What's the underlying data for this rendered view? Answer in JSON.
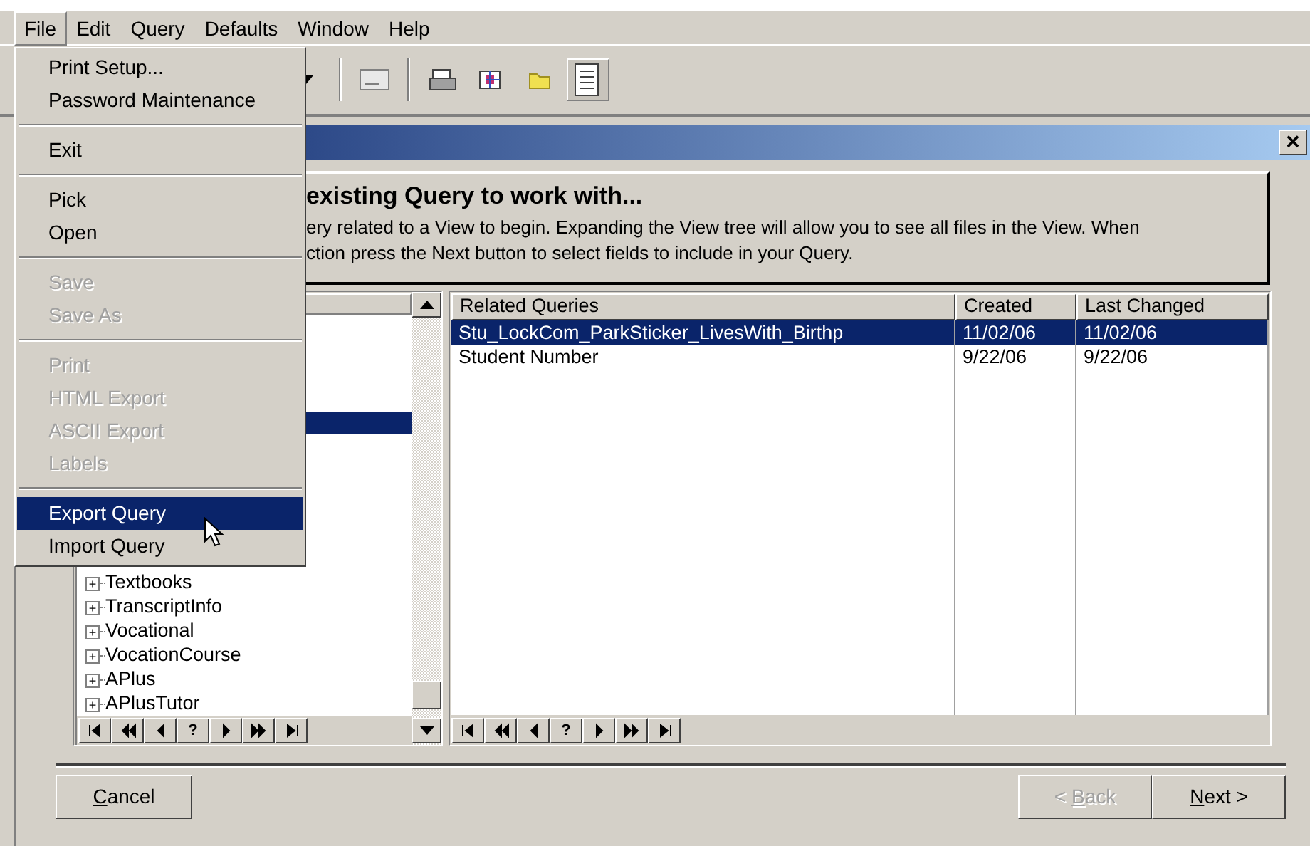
{
  "menu_bar": [
    {
      "label": "File",
      "selected": true
    },
    {
      "label": "Edit",
      "selected": false
    },
    {
      "label": "Query",
      "selected": false
    },
    {
      "label": "Defaults",
      "selected": false
    },
    {
      "label": "Window",
      "selected": false
    },
    {
      "label": "Help",
      "selected": false
    }
  ],
  "file_menu": [
    {
      "kind": "item",
      "label": "Print Setup...",
      "disabled": false,
      "selected": false
    },
    {
      "kind": "item",
      "label": "Password Maintenance",
      "disabled": false,
      "selected": false
    },
    {
      "kind": "separator"
    },
    {
      "kind": "item",
      "label": "Exit",
      "disabled": false,
      "selected": false
    },
    {
      "kind": "separator"
    },
    {
      "kind": "item",
      "label": "Pick",
      "disabled": false,
      "selected": false
    },
    {
      "kind": "item",
      "label": "Open",
      "disabled": false,
      "selected": false
    },
    {
      "kind": "separator"
    },
    {
      "kind": "item",
      "label": "Save",
      "disabled": true,
      "selected": false
    },
    {
      "kind": "item",
      "label": "Save As",
      "disabled": true,
      "selected": false
    },
    {
      "kind": "separator"
    },
    {
      "kind": "item",
      "label": "Print",
      "disabled": true,
      "selected": false
    },
    {
      "kind": "item",
      "label": "HTML Export",
      "disabled": true,
      "selected": false
    },
    {
      "kind": "item",
      "label": "ASCII Export",
      "disabled": true,
      "selected": false
    },
    {
      "kind": "item",
      "label": "Labels",
      "disabled": true,
      "selected": false
    },
    {
      "kind": "separator"
    },
    {
      "kind": "item",
      "label": "Export Query",
      "disabled": false,
      "selected": true
    },
    {
      "kind": "item",
      "label": "Import Query",
      "disabled": false,
      "selected": false
    }
  ],
  "dialog": {
    "close": "×",
    "header": {
      "title": "existing Query to work with...",
      "lines": [
        "ery related to a View to begin. Expanding the View tree will allow you to see all files in the View. When",
        "ction press the Next button to select fields to include in your Query."
      ]
    },
    "tree": {
      "highlight": true,
      "items": [
        {
          "label": "Textbooks",
          "expander": "+"
        },
        {
          "label": "TranscriptInfo",
          "expander": "+"
        },
        {
          "label": "Vocational",
          "expander": "+"
        },
        {
          "label": "VocationCourse",
          "expander": "+"
        },
        {
          "label": "APlus",
          "expander": "+"
        },
        {
          "label": "APlusTutor",
          "expander": "+"
        }
      ]
    },
    "nav": [
      {
        "kind": "first"
      },
      {
        "kind": "prev-page"
      },
      {
        "kind": "prev"
      },
      {
        "kind": "help",
        "label": "?"
      },
      {
        "kind": "next"
      },
      {
        "kind": "next-page"
      },
      {
        "kind": "last"
      }
    ],
    "queries": {
      "columns": [
        "Related Queries",
        "Created",
        "Last Changed"
      ],
      "rows": [
        {
          "cells": [
            "Stu_LockCom_ParkSticker_LivesWith_Birthp",
            "11/02/06",
            "11/02/06"
          ],
          "selected": true
        },
        {
          "cells": [
            "Student Number",
            "9/22/06",
            "9/22/06"
          ],
          "selected": false
        }
      ]
    },
    "buttons": [
      {
        "key": "C",
        "after": "ancel",
        "disabled": false,
        "kind": "left"
      },
      {
        "before": "< ",
        "key": "B",
        "after": "ack",
        "disabled": true,
        "kind": "right"
      },
      {
        "key": "N",
        "after": "ext >",
        "disabled": false,
        "kind": "right"
      }
    ]
  }
}
